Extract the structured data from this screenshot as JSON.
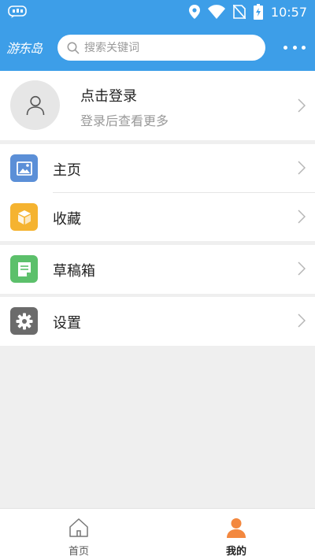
{
  "status_bar": {
    "time": "10:57",
    "icons": [
      "app-notification-icon",
      "location-icon",
      "wifi-icon",
      "no-sim-icon",
      "battery-charging-icon"
    ]
  },
  "header": {
    "logo_text": "游东岛",
    "search_placeholder": "搜索关键词",
    "search_value": "",
    "more_icon": "more-dots-icon"
  },
  "profile": {
    "title": "点击登录",
    "subtitle": "登录后查看更多",
    "avatar_icon": "user-icon"
  },
  "menu": {
    "home": {
      "label": "主页",
      "icon": "image-icon",
      "color": "#5b8fd7"
    },
    "favorites": {
      "label": "收藏",
      "icon": "box-icon",
      "color": "#f5b330"
    },
    "drafts": {
      "label": "草稿箱",
      "icon": "document-icon",
      "color": "#5cc06b"
    },
    "settings": {
      "label": "设置",
      "icon": "gear-icon",
      "color": "#6b6b6b"
    }
  },
  "tabbar": {
    "home": {
      "label": "首页",
      "active": false
    },
    "mine": {
      "label": "我的",
      "active": true
    }
  },
  "colors": {
    "primary": "#3d9ee8",
    "accent": "#f3883f",
    "background": "#efefef"
  }
}
